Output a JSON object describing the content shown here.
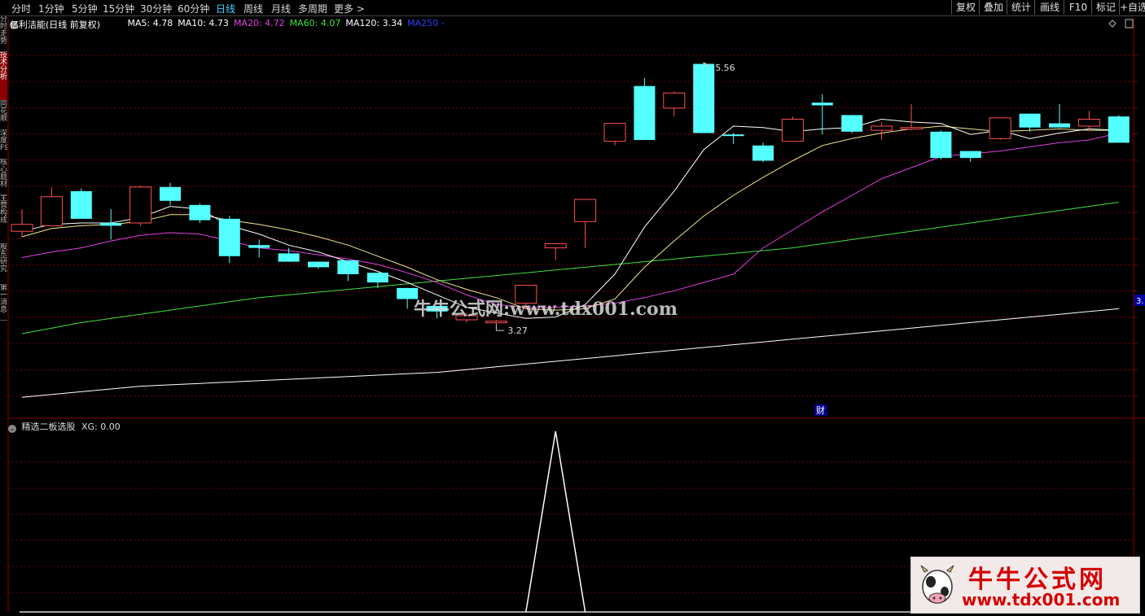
{
  "periods": [
    "分时",
    "1分钟",
    "5分钟",
    "15分钟",
    "30分钟",
    "60分钟",
    "日线",
    "周线",
    "月线",
    "多周期",
    "更多 >"
  ],
  "active_period": "日线",
  "right_buttons": [
    "复权",
    "叠加",
    "统计",
    "画线",
    "F10",
    "标记",
    "+自选"
  ],
  "left_tabs": [
    "分时走势",
    "技术分析",
    "同花顺",
    "深度F9",
    "核心题材",
    "主营构成",
    "股东研究",
    "第一消息"
  ],
  "stock_title": "亿利洁能(日线 前复权)",
  "ma_legend": [
    {
      "label": "MA5: 4.78",
      "color": "#ffffff"
    },
    {
      "label": "MA10: 4.73",
      "color": "#ffffff"
    },
    {
      "label": "MA20: 4.72",
      "color": "#e040e0"
    },
    {
      "label": "MA60: 4.07",
      "color": "#40e040"
    },
    {
      "label": "MA120: 3.34",
      "color": "#ffffff"
    },
    {
      "label": "MA250 -",
      "color": "#3040ff"
    }
  ],
  "high_label": "5.56",
  "low_label": "3.27",
  "right_price_tag": "3.",
  "finance_marker": "财",
  "watermark_text": "牛牛公式网:www.tdx001.com",
  "indicator_title": "精选二板选股",
  "indicator_value": "XG: 0.00",
  "logo_title": "牛牛公式网",
  "logo_url": "www.tdx001.com",
  "colors": {
    "up": "#ff5050",
    "down": "#54ffff",
    "grid": "#7a0000",
    "ma5": "#ffffff",
    "ma10": "#f0e68c",
    "ma20": "#e040e0",
    "ma60": "#40e040",
    "ma120": "#ffffff"
  },
  "chart_data": {
    "type": "candlestick",
    "price_axis_range": [
      3.0,
      5.8
    ],
    "candles": [
      {
        "o": 4.34,
        "c": 4.39,
        "h": 4.5,
        "l": 4.3
      },
      {
        "o": 4.38,
        "c": 4.59,
        "h": 4.66,
        "l": 4.38
      },
      {
        "o": 4.63,
        "c": 4.43,
        "h": 4.65,
        "l": 4.43
      },
      {
        "o": 4.4,
        "c": 4.38,
        "h": 4.5,
        "l": 4.28
      },
      {
        "o": 4.4,
        "c": 4.66,
        "h": 4.67,
        "l": 4.38
      },
      {
        "o": 4.66,
        "c": 4.56,
        "h": 4.69,
        "l": 4.53
      },
      {
        "o": 4.53,
        "c": 4.42,
        "h": 4.54,
        "l": 4.4
      },
      {
        "o": 4.43,
        "c": 4.16,
        "h": 4.45,
        "l": 4.11
      },
      {
        "o": 4.24,
        "c": 4.22,
        "h": 4.28,
        "l": 4.15
      },
      {
        "o": 4.18,
        "c": 4.12,
        "h": 4.22,
        "l": 4.12
      },
      {
        "o": 4.12,
        "c": 4.08,
        "h": 4.12,
        "l": 4.07
      },
      {
        "o": 4.13,
        "c": 4.03,
        "h": 4.13,
        "l": 3.98
      },
      {
        "o": 4.04,
        "c": 3.97,
        "h": 4.04,
        "l": 3.93
      },
      {
        "o": 3.93,
        "c": 3.85,
        "h": 3.93,
        "l": 3.78
      },
      {
        "o": 3.8,
        "c": 3.76,
        "h": 3.8,
        "l": 3.71
      },
      {
        "o": 3.7,
        "c": 3.73,
        "h": 3.75,
        "l": 3.68
      },
      {
        "o": 3.68,
        "c": 3.69,
        "h": 3.7,
        "l": 3.67
      },
      {
        "o": 3.82,
        "c": 3.95,
        "h": 3.95,
        "l": 3.78
      },
      {
        "o": 4.22,
        "c": 4.25,
        "h": 4.25,
        "l": 4.13
      },
      {
        "o": 4.41,
        "c": 4.57,
        "h": 4.57,
        "l": 4.22
      },
      {
        "o": 4.99,
        "c": 5.12,
        "h": 5.12,
        "l": 4.96
      },
      {
        "o": 5.39,
        "c": 5.0,
        "h": 5.45,
        "l": 5.0
      },
      {
        "o": 5.23,
        "c": 5.34,
        "h": 5.35,
        "l": 5.17
      },
      {
        "o": 5.55,
        "c": 5.05,
        "h": 5.56,
        "l": 5.05
      },
      {
        "o": 5.04,
        "c": 5.03,
        "h": 5.05,
        "l": 4.97
      },
      {
        "o": 4.96,
        "c": 4.85,
        "h": 4.98,
        "l": 4.84
      },
      {
        "o": 4.99,
        "c": 5.15,
        "h": 5.17,
        "l": 4.99
      },
      {
        "o": 5.27,
        "c": 5.25,
        "h": 5.33,
        "l": 5.04
      },
      {
        "o": 5.18,
        "c": 5.06,
        "h": 5.18,
        "l": 5.05
      },
      {
        "o": 5.07,
        "c": 5.1,
        "h": 5.13,
        "l": 5.0
      },
      {
        "o": 5.08,
        "c": 5.09,
        "h": 5.26,
        "l": 5.07
      },
      {
        "o": 5.06,
        "c": 4.87,
        "h": 5.07,
        "l": 4.86
      },
      {
        "o": 4.92,
        "c": 4.87,
        "h": 4.92,
        "l": 4.84
      },
      {
        "o": 5.01,
        "c": 5.16,
        "h": 5.16,
        "l": 5.0
      },
      {
        "o": 5.19,
        "c": 5.09,
        "h": 5.19,
        "l": 5.06
      },
      {
        "o": 5.12,
        "c": 5.09,
        "h": 5.26,
        "l": 5.1
      },
      {
        "o": 5.1,
        "c": 5.15,
        "h": 5.21,
        "l": 5.07
      },
      {
        "o": 5.17,
        "c": 4.98,
        "h": 5.18,
        "l": 4.98
      }
    ],
    "ma5": [
      4.34,
      4.39,
      4.4,
      4.4,
      4.44,
      4.52,
      4.5,
      4.38,
      4.32,
      4.24,
      4.19,
      4.12,
      4.05,
      3.97,
      3.88,
      3.79,
      3.75,
      3.71,
      3.72,
      3.81,
      4.03,
      4.37,
      4.63,
      4.93,
      5.1,
      5.09,
      5.06,
      5.08,
      5.09,
      5.15,
      5.13,
      5.12,
      5.04,
      5.07,
      5.01,
      5.05,
      5.08,
      5.07
    ],
    "ma10": [
      4.3,
      4.36,
      4.38,
      4.39,
      4.41,
      4.46,
      4.46,
      4.42,
      4.39,
      4.35,
      4.3,
      4.24,
      4.16,
      4.08,
      3.99,
      3.92,
      3.86,
      3.78,
      3.77,
      3.78,
      3.85,
      4.08,
      4.27,
      4.45,
      4.6,
      4.73,
      4.85,
      4.96,
      5.01,
      5.05,
      5.08,
      5.1,
      5.08,
      5.06,
      5.07,
      5.08,
      5.07,
      5.07
    ],
    "ma20": [
      4.15,
      4.19,
      4.22,
      4.27,
      4.31,
      4.33,
      4.32,
      4.27,
      4.22,
      4.2,
      4.17,
      4.14,
      4.1,
      4.04,
      3.97,
      3.88,
      3.81,
      3.79,
      3.79,
      3.8,
      3.82,
      3.86,
      3.91,
      3.97,
      4.03,
      4.22,
      4.35,
      4.48,
      4.6,
      4.72,
      4.8,
      4.88,
      4.9,
      4.92,
      4.95,
      4.98,
      5.0,
      5.05
    ],
    "ma60": [
      3.6,
      3.64,
      3.68,
      3.71,
      3.74,
      3.77,
      3.8,
      3.83,
      3.86,
      3.88,
      3.9,
      3.92,
      3.94,
      3.96,
      3.98,
      4.0,
      4.02,
      4.04,
      4.06,
      4.08,
      4.1,
      4.12,
      4.14,
      4.16,
      4.18,
      4.2,
      4.22,
      4.25,
      4.28,
      4.31,
      4.34,
      4.37,
      4.4,
      4.43,
      4.46,
      4.49,
      4.52,
      4.55
    ],
    "ma120": [
      3.14,
      3.16,
      3.18,
      3.2,
      3.22,
      3.23,
      3.24,
      3.25,
      3.26,
      3.27,
      3.28,
      3.29,
      3.3,
      3.31,
      3.32,
      3.34,
      3.36,
      3.38,
      3.4,
      3.42,
      3.44,
      3.46,
      3.48,
      3.5,
      3.52,
      3.54,
      3.56,
      3.58,
      3.6,
      3.62,
      3.64,
      3.66,
      3.68,
      3.7,
      3.72,
      3.74,
      3.76,
      3.78
    ],
    "indicator_values": [
      0,
      0,
      0,
      0,
      0,
      0,
      0,
      0,
      0,
      0,
      0,
      0,
      0,
      0,
      0,
      0,
      0,
      0,
      1,
      0,
      0,
      0,
      0,
      0,
      0,
      0,
      0,
      0,
      0,
      0,
      0,
      0,
      0,
      0,
      0,
      0,
      0,
      0
    ]
  }
}
